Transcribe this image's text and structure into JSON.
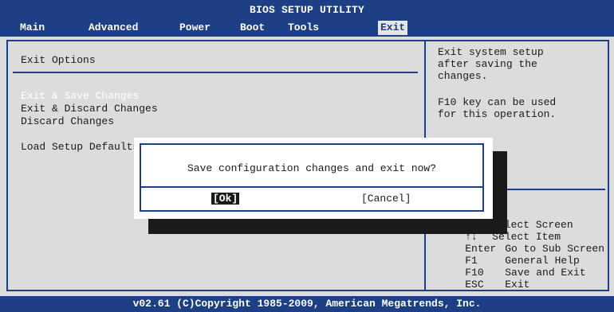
{
  "header": {
    "title": "BIOS SETUP UTILITY",
    "tabs": [
      "Main",
      "Advanced",
      "Power",
      "Boot",
      "Tools",
      "Exit"
    ],
    "active_tab": "Exit"
  },
  "content": {
    "section_title": "Exit Options",
    "options": [
      "Exit & Save Changes",
      "Exit & Discard Changes",
      "Discard Changes",
      "Load Setup Defaults"
    ]
  },
  "help": {
    "line1": "Exit system setup",
    "line2": "after saving the",
    "line3": "changes.",
    "line4": "F10 key can be used",
    "line5": "for this operation."
  },
  "keys": [
    {
      "key": "←→",
      "desc": "Select Screen"
    },
    {
      "key": "↑↓",
      "desc": "Select Item"
    },
    {
      "key": "Enter",
      "desc": "Go to Sub Screen"
    },
    {
      "key": "F1",
      "desc": "General Help"
    },
    {
      "key": "F10",
      "desc": "Save and Exit"
    },
    {
      "key": "ESC",
      "desc": "Exit"
    }
  ],
  "footer": {
    "text": "v02.61 (C)Copyright 1985-2009, American Megatrends, Inc."
  },
  "dialog": {
    "message": "Save configuration changes and exit now?",
    "ok_label": "[Ok]",
    "cancel_label": "[Cancel]"
  },
  "colors": {
    "bar_blue": "#1c3f86",
    "panel_gray": "#dcdcdc",
    "highlight_white": "#ffffff"
  }
}
